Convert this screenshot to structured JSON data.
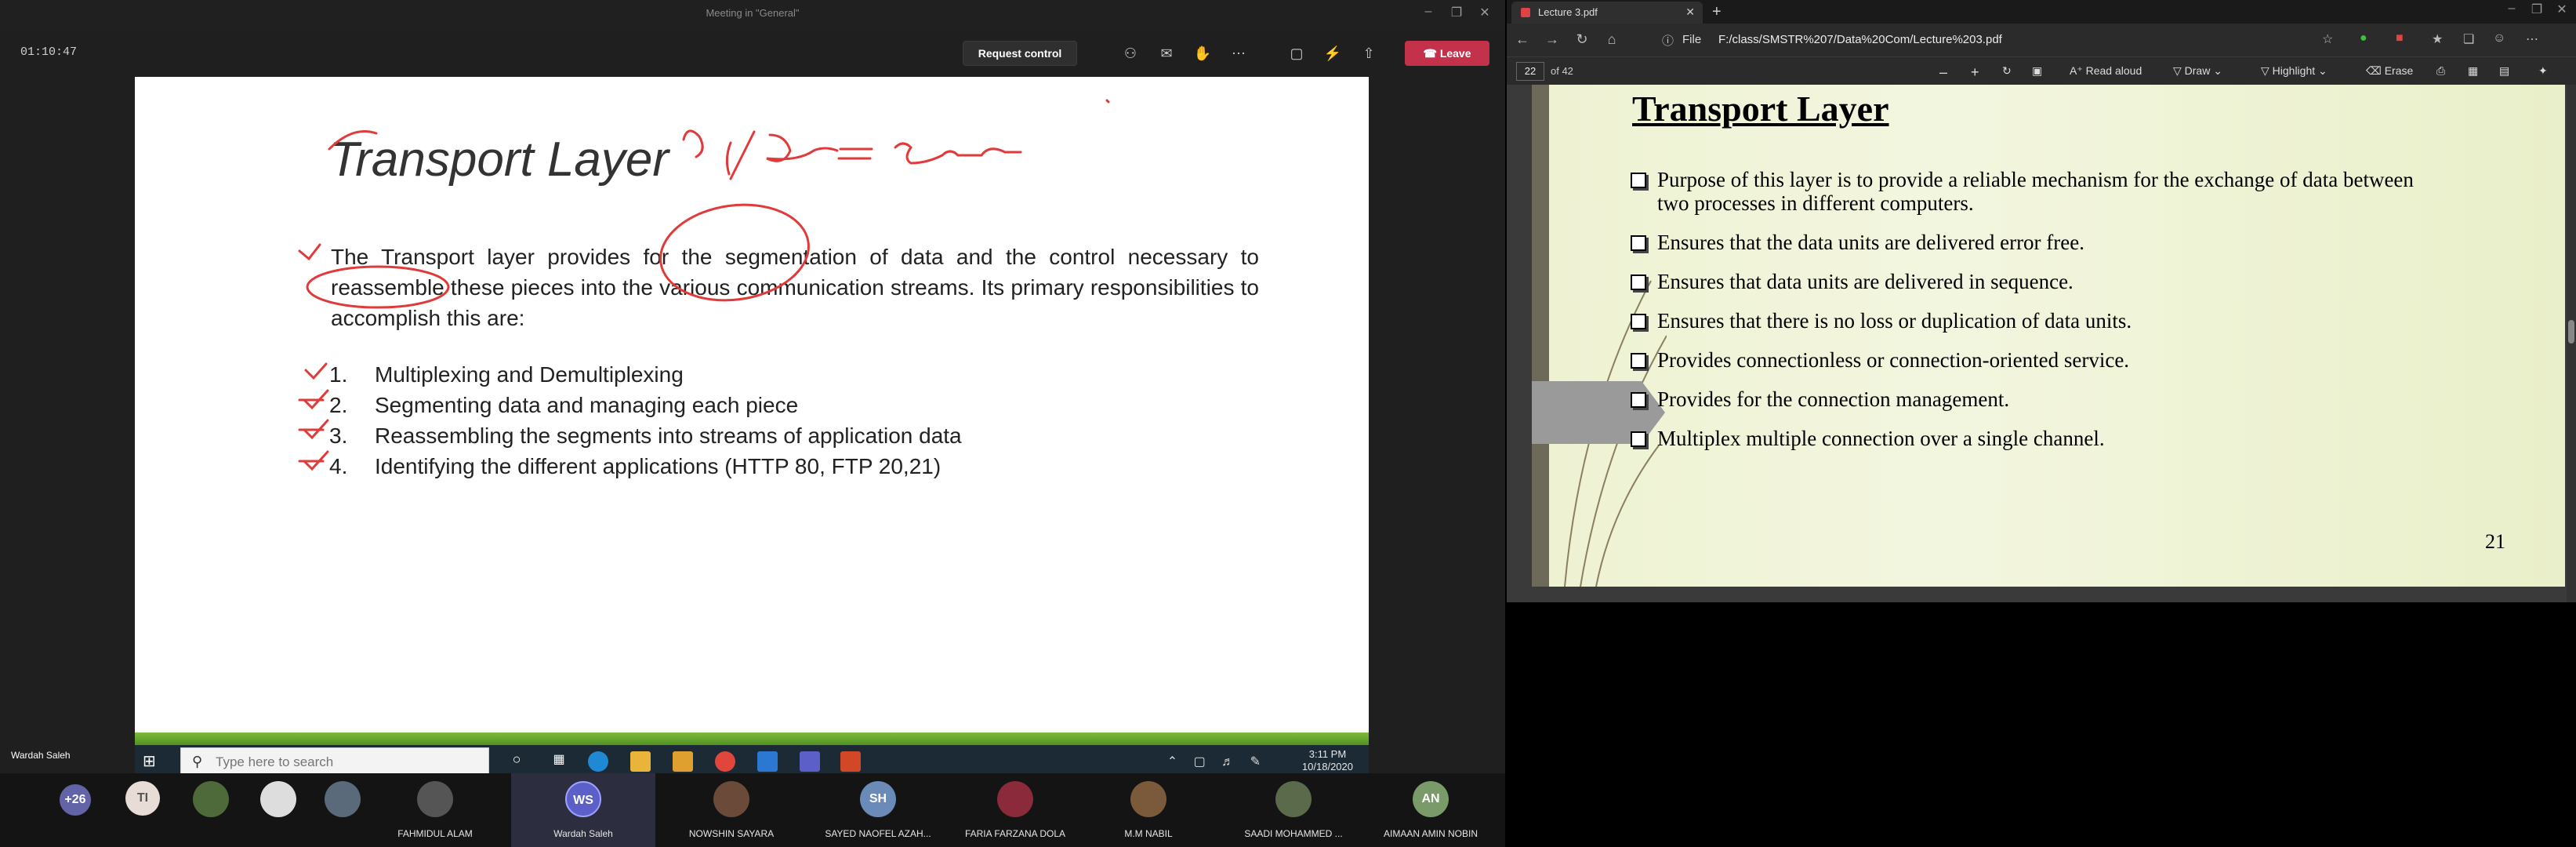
{
  "teams": {
    "window_title": "Meeting in \"General\"",
    "timer": "01:10:47",
    "request_control_label": "Request control",
    "leave_label": "Leave",
    "presenter_label": "Wardah Saleh",
    "icons": [
      "people-icon",
      "chat-icon",
      "raise-hand-icon",
      "more-icon",
      "camera-off-icon",
      "mic-off-icon",
      "share-tray-icon"
    ]
  },
  "slide": {
    "title": "Transport Layer",
    "annotation": "msg/data = segment",
    "paragraph": "The Transport layer provides for the segmentation of data and the control necessary to reassemble these pieces into the various communication streams. Its primary responsibilities to accomplish this are:",
    "items": [
      {
        "num": "1.",
        "text": "Multiplexing and Demultiplexing"
      },
      {
        "num": "2.",
        "text": "Segmenting data and managing each piece"
      },
      {
        "num": "3.",
        "text": "Reassembling the segments into streams of application data"
      },
      {
        "num": "4.",
        "text": "Identifying the different applications (HTTP 80, FTP 20,21)"
      }
    ]
  },
  "taskbar": {
    "search_placeholder": "Type here to search",
    "time": "3:11 PM",
    "date": "10/18/2020"
  },
  "participants": [
    {
      "initials": "+26",
      "name": "",
      "color": "#6264a7"
    },
    {
      "initials": "TI",
      "name": "",
      "color": "#d9d0c8"
    },
    {
      "initials": "",
      "name": "",
      "color": "#4f6a3a"
    },
    {
      "initials": "",
      "name": "",
      "color": "#3a3a3a"
    },
    {
      "initials": "",
      "name": "",
      "color": "#5a6a7a"
    },
    {
      "initials": "",
      "name": "FAHMIDUL ALAM",
      "color": "#444"
    },
    {
      "initials": "WS",
      "name": "Wardah Saleh",
      "color": "#5b5fc7"
    },
    {
      "initials": "",
      "name": "NOWSHIN SAYARA",
      "color": "#6b4a3a"
    },
    {
      "initials": "SH",
      "name": "SAYED NAOFEL AZAH...",
      "color": "#6a8ab8"
    },
    {
      "initials": "",
      "name": "FARIA FARZANA DOLA",
      "color": "#8a2a3a"
    },
    {
      "initials": "",
      "name": "M.M NABIL",
      "color": "#7a5a3a"
    },
    {
      "initials": "",
      "name": "SAADI MOHAMMED ...",
      "color": "#5a6a4a"
    },
    {
      "initials": "AN",
      "name": "AIMAAN AMIN NOBIN",
      "color": "#7a9a6a"
    }
  ],
  "edge": {
    "tab_title": "Lecture 3.pdf",
    "url_scheme": "File",
    "url": "F:/class/SMSTR%207/Data%20Com/Lecture%203.pdf",
    "page_current": "22",
    "page_total": "of 42",
    "tools": {
      "read_aloud": "Read aloud",
      "draw": "Draw",
      "highlight": "Highlight",
      "erase": "Erase"
    }
  },
  "pdf": {
    "title": "Transport Layer",
    "bullets": [
      "Purpose of this layer is to provide a reliable mechanism for the exchange of data between two processes in different computers.",
      "Ensures that the data units are delivered error free.",
      "Ensures that data units are delivered in sequence.",
      "Ensures that there is no loss or duplication of data units.",
      "Provides connectionless or connection-oriented service.",
      "Provides for the connection management.",
      "Multiplex  multiple connection over a single channel."
    ],
    "page_number": "21"
  }
}
